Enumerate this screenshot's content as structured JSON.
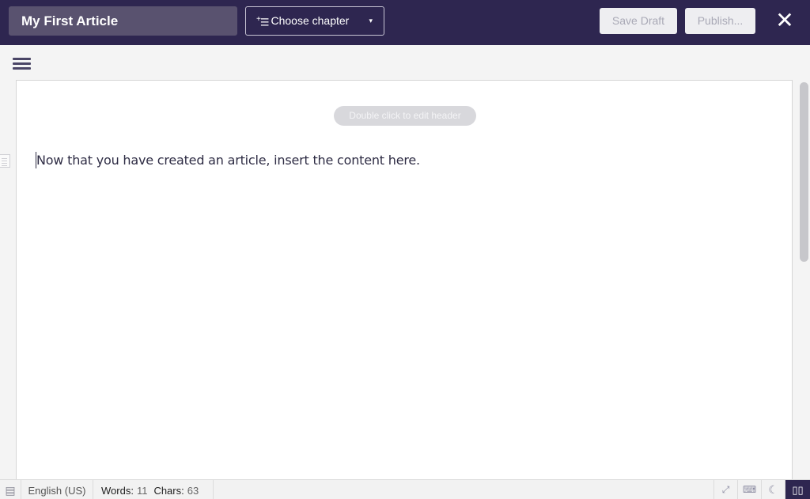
{
  "topbar": {
    "title": "My First Article",
    "chapter_button": {
      "label": "Choose chapter",
      "icon": "add-list-icon",
      "caret": "▾"
    },
    "save_draft": "Save Draft",
    "publish": "Publish...",
    "close_glyph": "✕"
  },
  "editor": {
    "header_placeholder": "Double click to edit header",
    "content": "Now that you have created an article, insert the content here."
  },
  "statusbar": {
    "spellcheck_glyph": "📋",
    "language": "English (US)",
    "words_label": "Words:",
    "words": "11",
    "chars_label": "Chars:",
    "chars": "63",
    "fullscreen_glyph": "⤢",
    "keyboard_glyph": "⌨",
    "dark_mode_glyph": "☾",
    "reading_mode_glyph": "📖"
  }
}
